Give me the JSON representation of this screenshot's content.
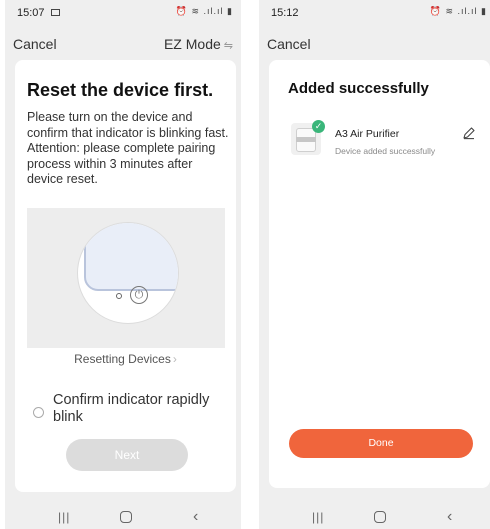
{
  "left_screen": {
    "status": {
      "time": "15:07"
    },
    "topbar": {
      "cancel_label": "Cancel",
      "mode_label": "EZ Mode",
      "mode_icon": "⇋"
    },
    "card": {
      "title": "Reset the device first.",
      "body": "Please turn on the device and confirm that indicator is blinking fast.\nAttention: please complete pairing process within 3 minutes after device reset.",
      "resetting_label": "Resetting Devices",
      "resetting_chevron": "›",
      "confirm_label": "Confirm indicator rapidly blink",
      "next_label": "Next"
    }
  },
  "right_screen": {
    "status": {
      "time": "15:12"
    },
    "topbar": {
      "cancel_label": "Cancel"
    },
    "card": {
      "title": "Added successfully",
      "device_name": "A3 Air Purifier",
      "device_status": "Device added successfully",
      "done_label": "Done"
    }
  },
  "icons": {
    "status_right": "⏰ ≋ .ıl.ıl ▮",
    "power": "⏻",
    "check": "✓",
    "nav_recents": "|||",
    "nav_back": "‹"
  },
  "colors": {
    "accent": "#f0653c",
    "success": "#3ab67a",
    "next_disabled": "#dcdcdc",
    "background": "#efefef"
  }
}
